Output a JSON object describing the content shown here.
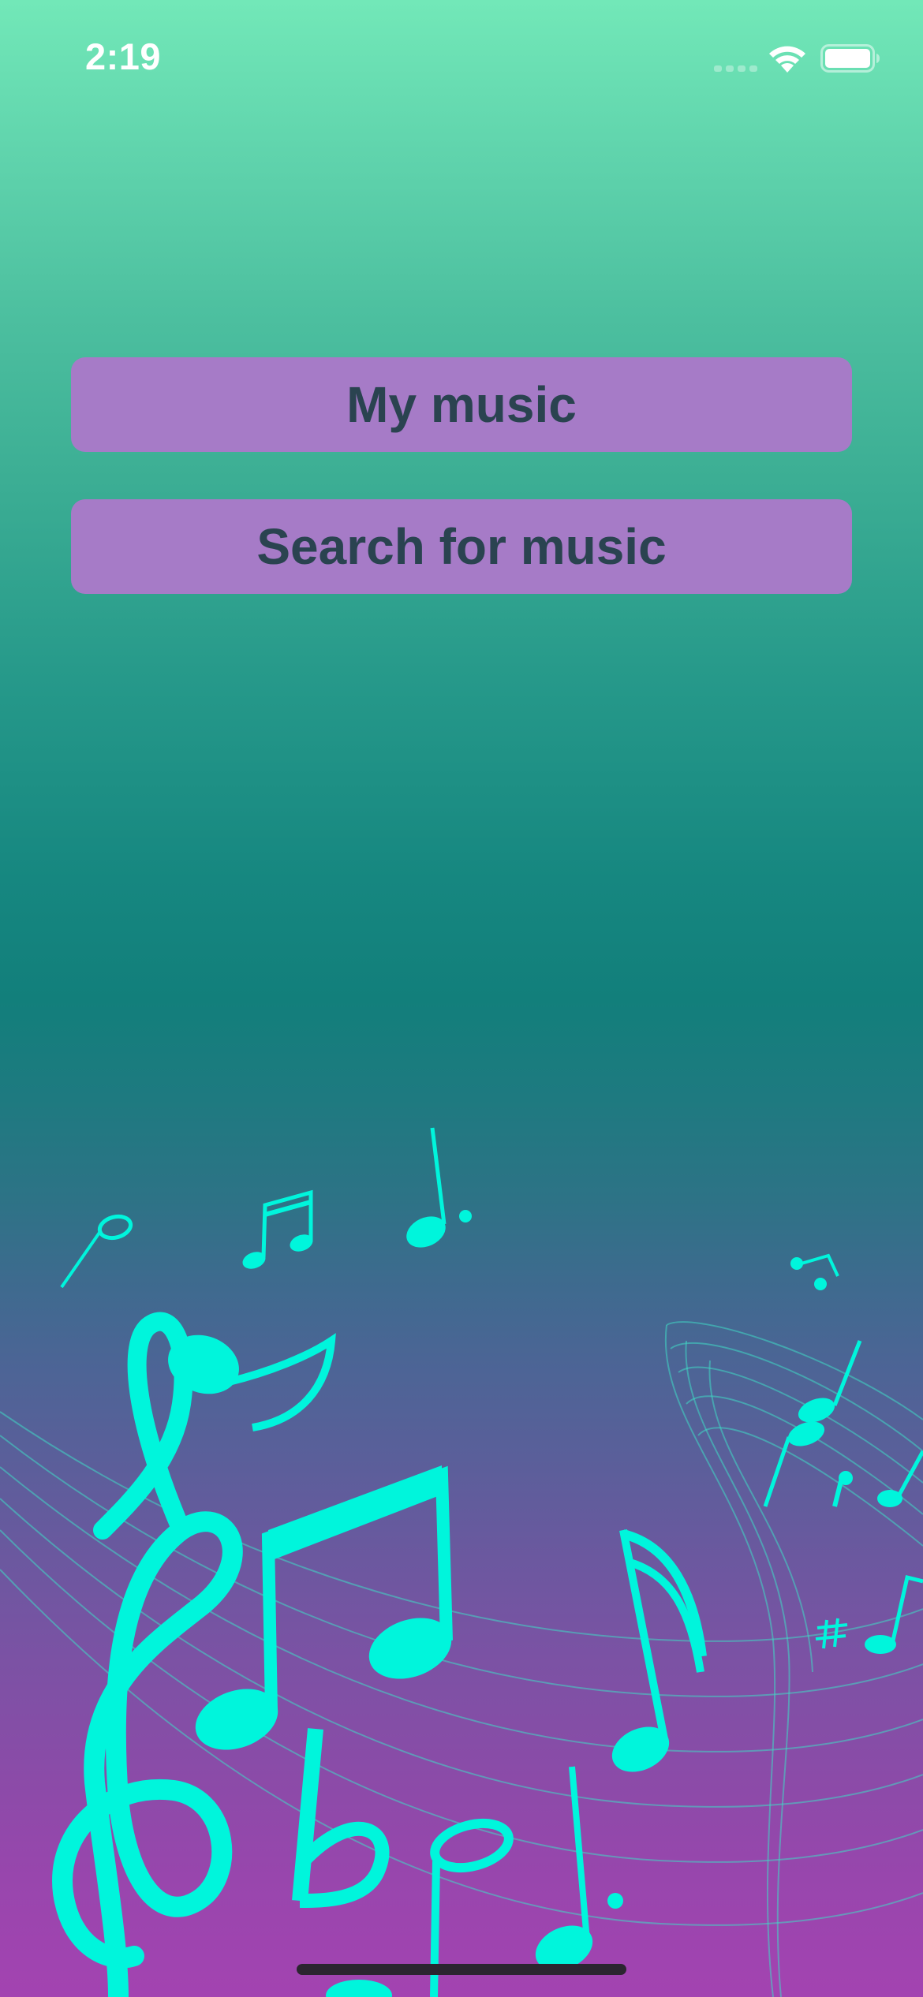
{
  "status_bar": {
    "time": "2:19",
    "icons": [
      "cellular-signal-icon",
      "wifi-icon",
      "battery-icon"
    ]
  },
  "menu": {
    "my_music_label": "My music",
    "search_label": "Search for music"
  },
  "colors": {
    "button_background": "#a67bc7",
    "button_text": "#2a4350",
    "gradient_top": "#72e8b8",
    "gradient_middle": "#127f7b",
    "gradient_bottom": "#a343b1",
    "music_note": "#00f5dc"
  },
  "background_art": {
    "icons": [
      "treble-clef-icon",
      "music-note-icon",
      "flat-icon",
      "sharp-icon",
      "music-staff-icon"
    ]
  }
}
